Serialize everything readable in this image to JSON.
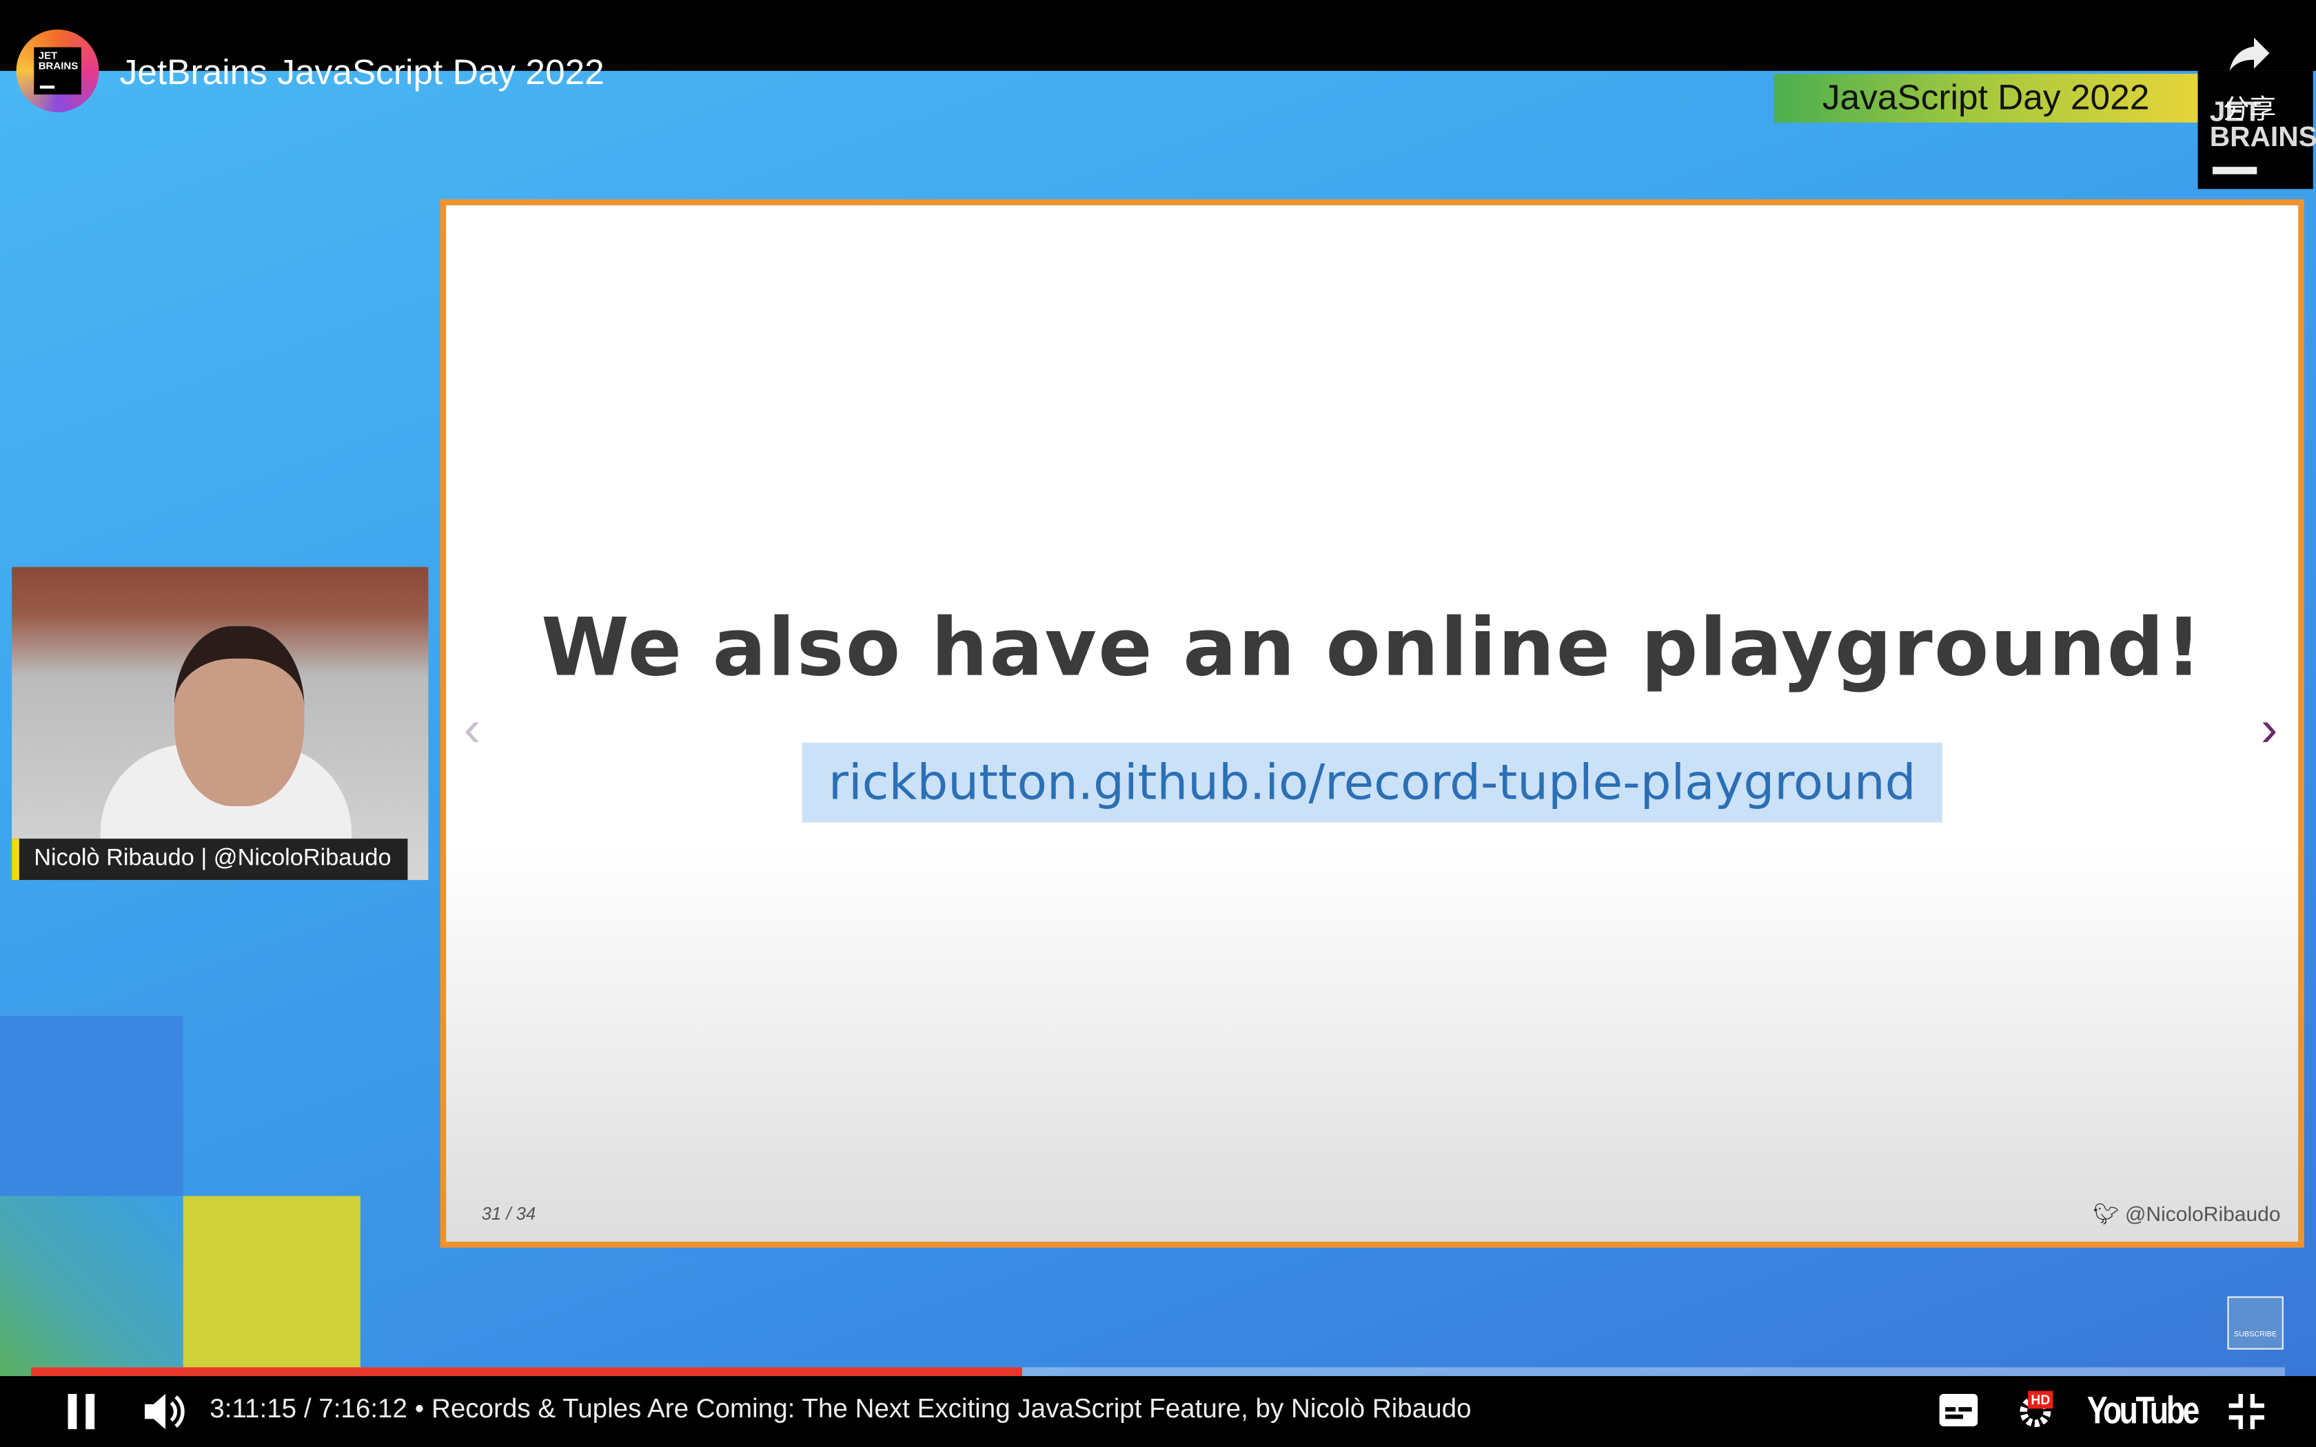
{
  "header": {
    "channel_logo_text": "JET BRAINS",
    "title": "JetBrains JavaScript Day 2022",
    "share_label": "分享"
  },
  "video": {
    "banner": "JavaScript Day 2022",
    "corner_logo": "JET BRAINS",
    "slide": {
      "heading": "We also have an online playground!",
      "link": "rickbutton.github.io/record-tuple-playground",
      "page": "31 / 34",
      "twitter_handle": "@NicoloRibaudo",
      "prev": "‹",
      "next": "›"
    },
    "speaker_name": "Nicolò Ribaudo | @NicoloRibaudo",
    "subscribe_label": "SUBSCRIBE"
  },
  "player": {
    "progress_percent": 44,
    "progress_color": "#e8382c",
    "time": "3:11:15 / 7:16:12",
    "separator": "•",
    "video_title": "Records & Tuples Are Coming: The Next Exciting JavaScript Feature, by Nicolò Ribaudo",
    "hd_badge": "HD",
    "brand": "YouTube",
    "icons": [
      "pause-icon",
      "volume-icon",
      "subtitles-icon",
      "settings-icon",
      "exit-fullscreen-icon",
      "share-icon"
    ]
  }
}
